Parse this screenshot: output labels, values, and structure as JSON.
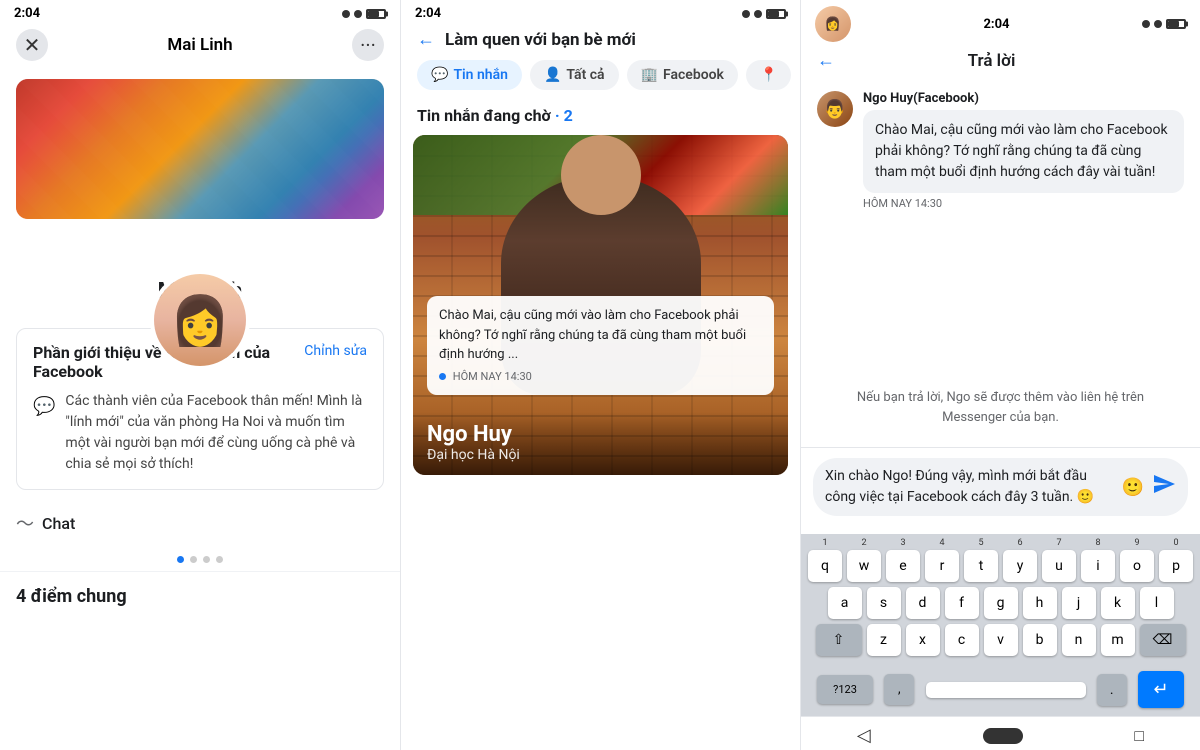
{
  "panel1": {
    "status_time": "2:04",
    "header_title": "Mai Linh",
    "profile_name": "Mai Linh",
    "intro_title": "Phần giới thiệu về thành viên của Facebook",
    "intro_edit": "Chỉnh sửa",
    "intro_text": "Các thành viên của Facebook thân mến! Mình là \"lính mới\" của văn phòng Ha Noi và muốn tìm một vài người bạn mới để cùng uống cà phê và chia sẻ mọi sở thích!",
    "chat_label": "Chat",
    "common_label": "4 điểm chung"
  },
  "panel2": {
    "status_time": "2:04",
    "header_title": "Làm quen với bạn bè mới",
    "filter_tabs": [
      {
        "label": "Tin nhắn",
        "active": true
      },
      {
        "label": "Tất cả",
        "active": false
      },
      {
        "label": "Facebook",
        "active": false
      }
    ],
    "pending_label": "Tin nhắn đang chờ",
    "pending_count": "2",
    "person_name": "Ngo Huy",
    "person_edu": "Đại học Hà Nội",
    "person_message": "Chào Mai, cậu cũng mới vào làm cho Facebook phải không? Tớ nghĩ rằng chúng ta đã cùng tham một buổi định hướng ...",
    "person_time": "HÔM NAY 14:30"
  },
  "panel3": {
    "status_time": "2:04",
    "header_title": "Trả lời",
    "sender_name": "Ngo Huy(Facebook)",
    "message_text": "Chào Mai, cậu cũng mới vào làm cho Facebook phải không? Tớ nghĩ rằng chúng ta đã cùng tham một buổi định hướng cách đây vài tuần!",
    "message_time": "HÔM NAY 14:30",
    "privacy_note": "Nếu bạn trả lời, Ngo sẽ được thêm vào liên hệ trên Messenger của bạn.",
    "reply_text": "Xin chào Ngo! Đúng vậy, mình mới bắt đầu công việc tại Facebook cách đây 3 tuần. 🙂",
    "keyboard": {
      "numbers": [
        "1",
        "2",
        "3",
        "4",
        "5",
        "6",
        "7",
        "8",
        "9",
        "0"
      ],
      "row1": [
        "q",
        "w",
        "e",
        "r",
        "t",
        "y",
        "u",
        "i",
        "o",
        "p"
      ],
      "row2": [
        "a",
        "s",
        "d",
        "f",
        "g",
        "h",
        "j",
        "k",
        "l"
      ],
      "row3": [
        "z",
        "x",
        "c",
        "v",
        "b",
        "n",
        "m"
      ],
      "special_left": "?123",
      "special_right": ".",
      "comma": ","
    }
  }
}
